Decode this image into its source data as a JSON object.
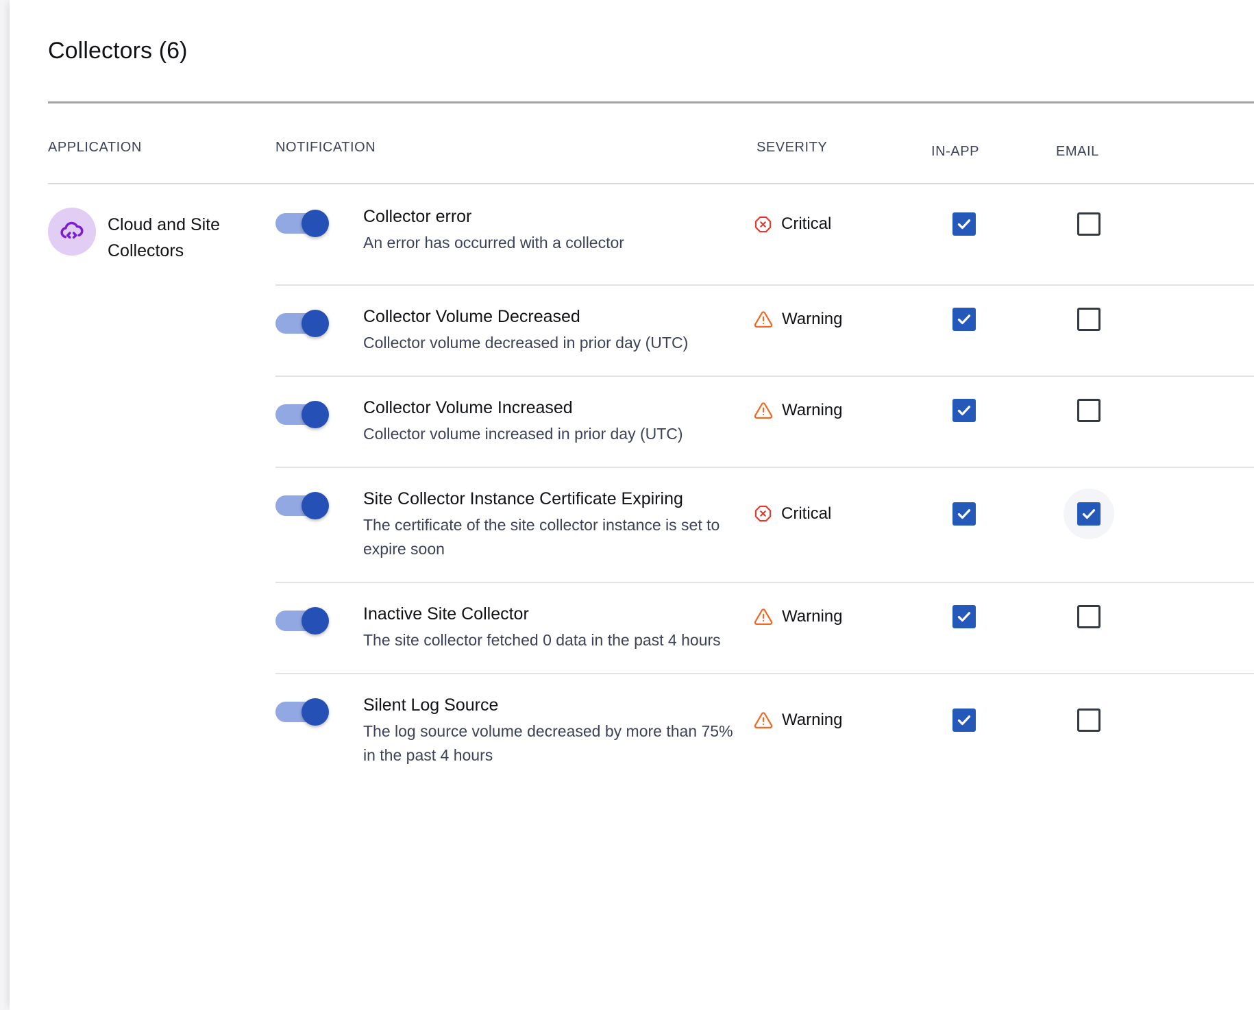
{
  "page": {
    "title": "Collectors (6)"
  },
  "columns": {
    "application": "APPLICATION",
    "notification": "NOTIFICATION",
    "severity": "SEVERITY",
    "in_app": "IN-APP",
    "email": "EMAIL"
  },
  "application": {
    "name": "Cloud and Site Collectors",
    "icon": "cloud-code-icon",
    "icon_color": "#7b1fd1",
    "icon_bg": "#e2cdf5"
  },
  "colors": {
    "toggle_on_track": "#91a8e2",
    "toggle_on_thumb": "#2550b5",
    "checkbox_checked": "#2459ba",
    "checkbox_border": "#343a44",
    "critical": "#e23a2e",
    "warning": "#f26722",
    "title_rule": "#a2a2a6",
    "row_divider": "#e3e3e7"
  },
  "severity_levels": {
    "critical": {
      "label": "Critical",
      "icon": "octagon-x-icon",
      "color": "#e23a2e"
    },
    "warning": {
      "label": "Warning",
      "icon": "triangle-alert-icon",
      "color": "#f26722"
    }
  },
  "rows": [
    {
      "enabled": true,
      "title": "Collector error",
      "description": "An error has occurred with a collector",
      "severity": "Critical",
      "severity_kind": "critical",
      "in_app": true,
      "email": false,
      "email_focused": false
    },
    {
      "enabled": true,
      "title": "Collector Volume Decreased",
      "description": "Collector volume decreased in prior day (UTC)",
      "severity": "Warning",
      "severity_kind": "warning",
      "in_app": true,
      "email": false,
      "email_focused": false
    },
    {
      "enabled": true,
      "title": "Collector Volume Increased",
      "description": "Collector volume increased in prior day (UTC)",
      "severity": "Warning",
      "severity_kind": "warning",
      "in_app": true,
      "email": false,
      "email_focused": false
    },
    {
      "enabled": true,
      "title": "Site Collector Instance Certificate Expiring",
      "description": "The certificate of the site collector instance is set to expire soon",
      "severity": "Critical",
      "severity_kind": "critical",
      "in_app": true,
      "email": true,
      "email_focused": true
    },
    {
      "enabled": true,
      "title": "Inactive Site Collector",
      "description": "The site collector fetched 0 data in the past 4 hours",
      "severity": "Warning",
      "severity_kind": "warning",
      "in_app": true,
      "email": false,
      "email_focused": false
    },
    {
      "enabled": true,
      "title": "Silent Log Source",
      "description": "The log source volume decreased by more than 75% in the past 4 hours",
      "severity": "Warning",
      "severity_kind": "warning",
      "in_app": true,
      "email": false,
      "email_focused": false
    }
  ]
}
